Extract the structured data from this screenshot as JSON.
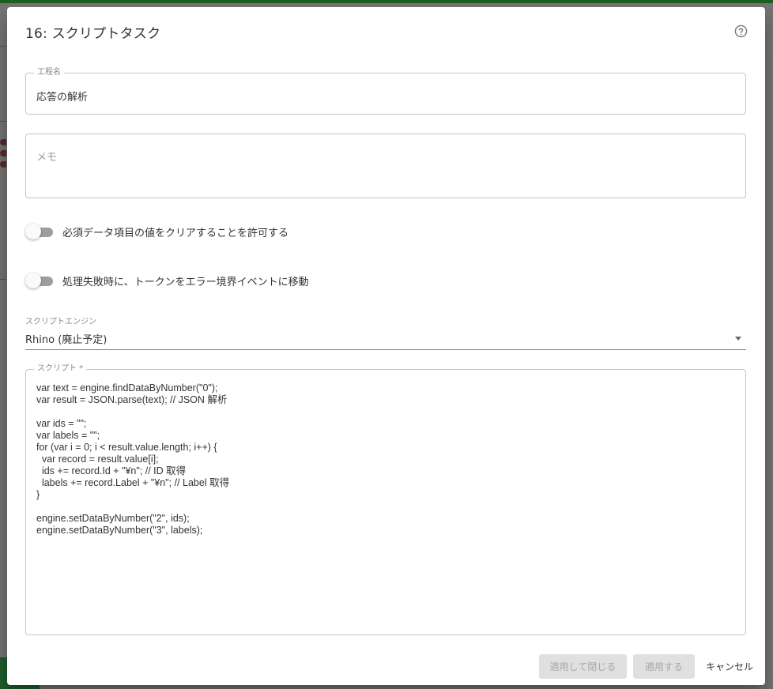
{
  "dialog": {
    "title": "16: スクリプトタスク",
    "help_icon": "help-circle-icon"
  },
  "process_name": {
    "label": "工程名",
    "value": "応答の解析"
  },
  "memo": {
    "placeholder": "メモ"
  },
  "toggles": [
    {
      "label": "必須データ項目の値をクリアすることを許可する",
      "checked": false
    },
    {
      "label": "処理失敗時に、トークンをエラー境界イベントに移動",
      "checked": false
    }
  ],
  "script_engine": {
    "label": "スクリプトエンジン",
    "selected": "Rhino (廃止予定)"
  },
  "script": {
    "label": "スクリプト *",
    "code": "var text = engine.findDataByNumber(\"0\");\nvar result = JSON.parse(text); // JSON 解析\n\nvar ids = \"\";\nvar labels = \"\";\nfor (var i = 0; i < result.value.length; i++) {\n  var record = result.value[i];\n  ids += record.Id + \"¥n\"; // ID 取得\n  labels += record.Label + \"¥n\"; // Label 取得\n}\n\nengine.setDataByNumber(\"2\", ids);\nengine.setDataByNumber(\"3\", labels);"
  },
  "footer": {
    "apply_close": "適用して閉じる",
    "apply": "適用する",
    "cancel": "キャンセル"
  },
  "colors": {
    "disabled_button_bg": "#e0e0e0",
    "disabled_button_text": "#a6a6a6",
    "toggle_track_off": "#9e9e9e"
  }
}
